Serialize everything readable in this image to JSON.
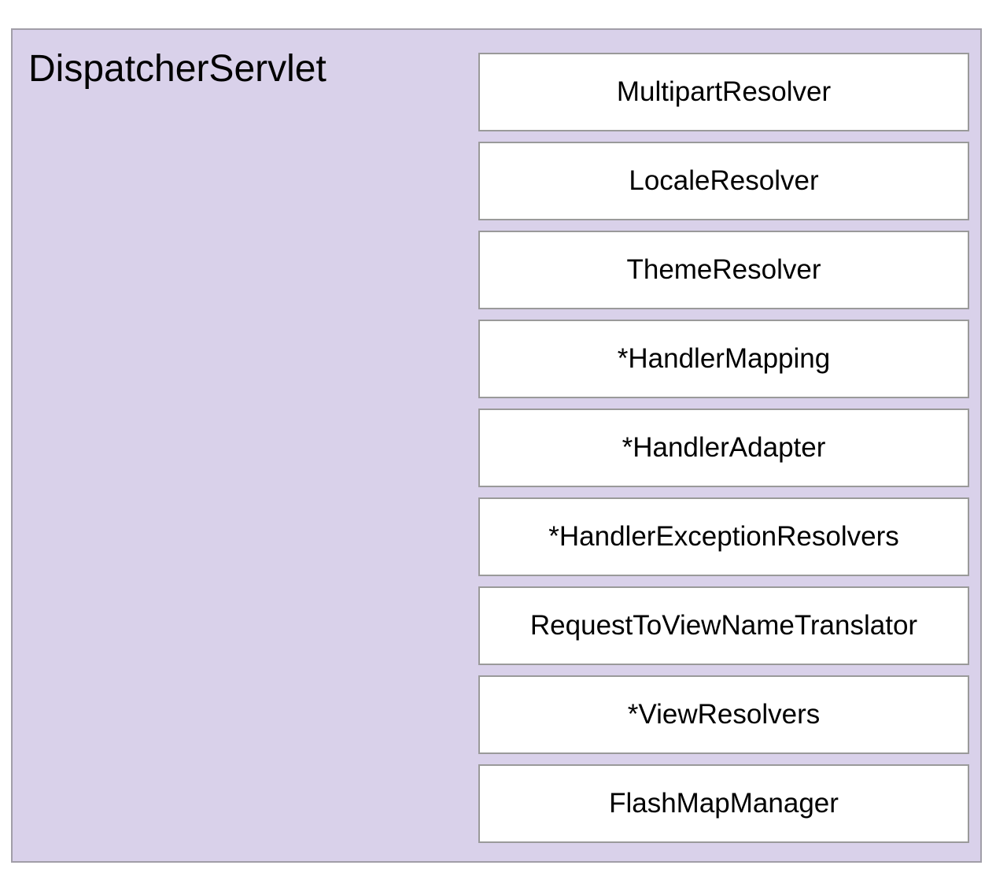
{
  "diagram": {
    "title": "DispatcherServlet",
    "components": [
      {
        "label": "MultipartResolver"
      },
      {
        "label": "LocaleResolver"
      },
      {
        "label": "ThemeResolver"
      },
      {
        "label": "*HandlerMapping"
      },
      {
        "label": "*HandlerAdapter"
      },
      {
        "label": "*HandlerExceptionResolvers"
      },
      {
        "label": "RequestToViewNameTranslator"
      },
      {
        "label": "*ViewResolvers"
      },
      {
        "label": "FlashMapManager"
      }
    ]
  },
  "colors": {
    "container_fill": "#d9d1ea",
    "container_border": "#a19ea8",
    "box_fill": "#ffffff",
    "box_border": "#9a9a9a"
  }
}
